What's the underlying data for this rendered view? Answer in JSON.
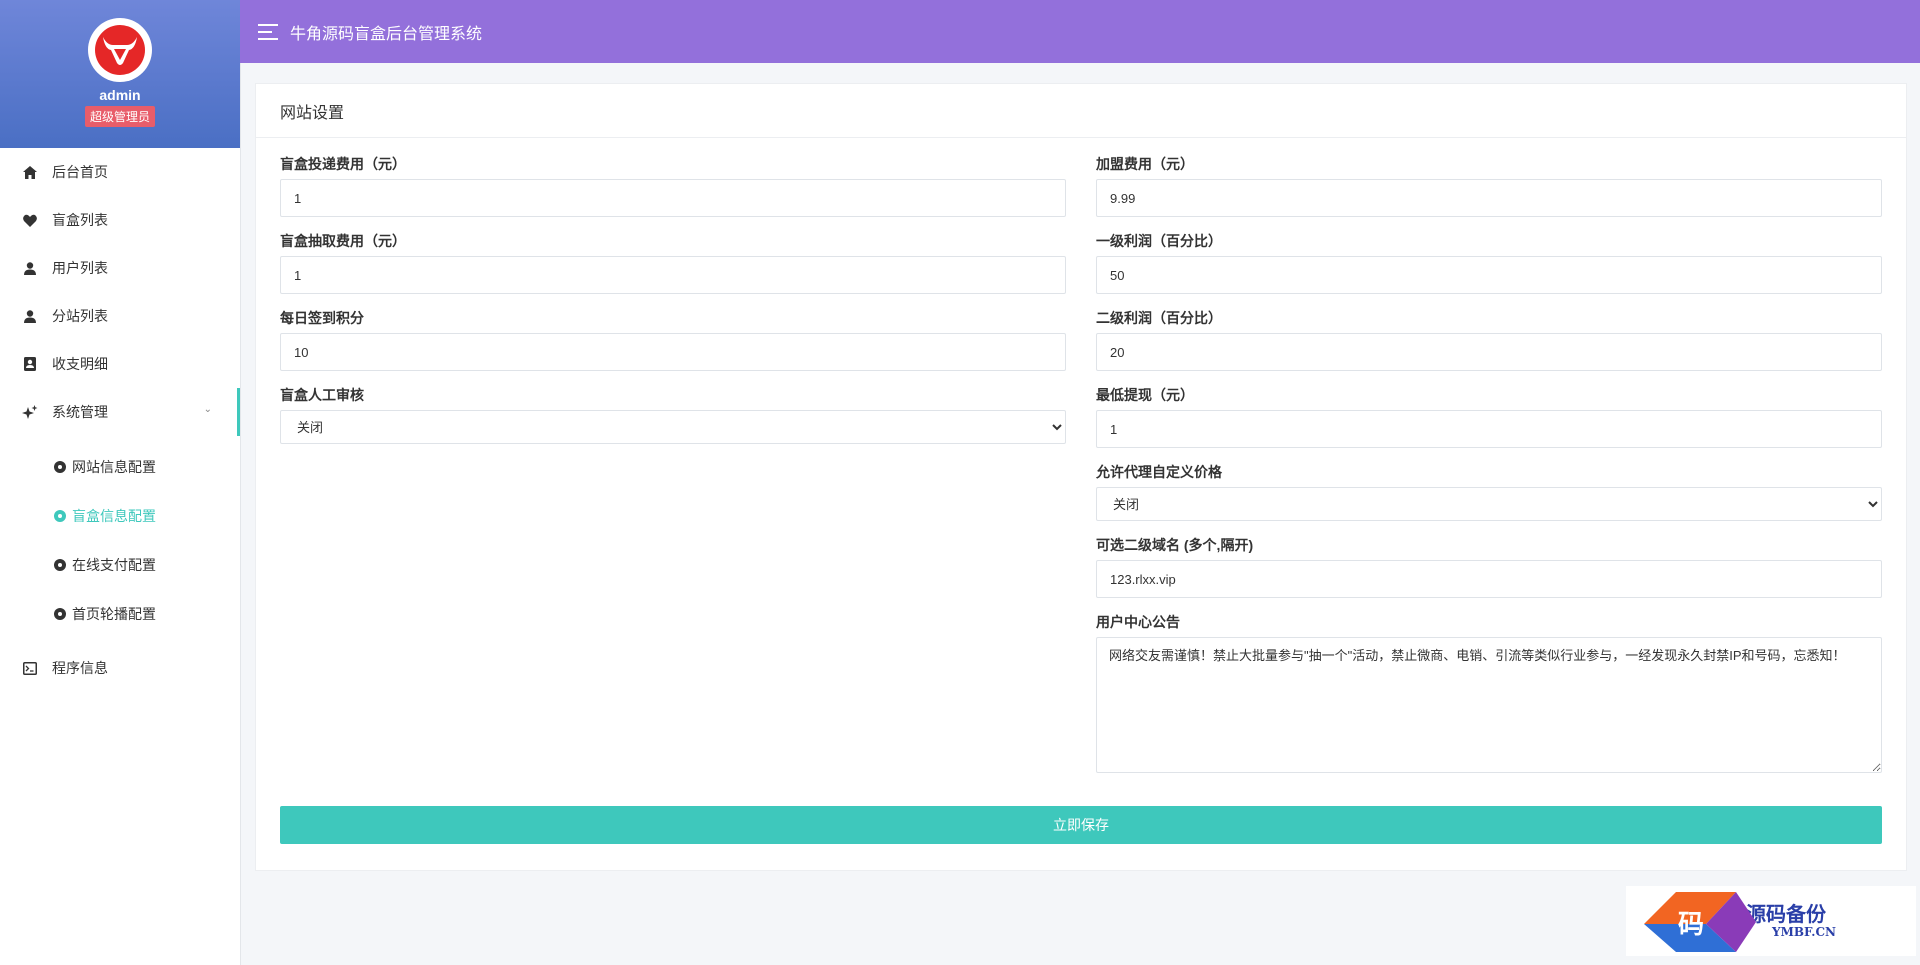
{
  "app": {
    "title": "牛角源码盲盒后台管理系统"
  },
  "profile": {
    "name": "admin",
    "role": "超级管理员"
  },
  "sidebar": {
    "items": [
      {
        "label": "后台首页",
        "icon": "home-icon"
      },
      {
        "label": "盲盒列表",
        "icon": "heart-icon"
      },
      {
        "label": "用户列表",
        "icon": "user-icon"
      },
      {
        "label": "分站列表",
        "icon": "user-icon"
      },
      {
        "label": "收支明细",
        "icon": "contact-card-icon"
      },
      {
        "label": "系统管理",
        "icon": "sparkle-icon"
      },
      {
        "label": "程序信息",
        "icon": "terminal-icon"
      }
    ],
    "submenu": [
      {
        "label": "网站信息配置"
      },
      {
        "label": "盲盒信息配置",
        "active": true
      },
      {
        "label": "在线支付配置"
      },
      {
        "label": "首页轮播配置"
      }
    ]
  },
  "card": {
    "title": "网站设置"
  },
  "form": {
    "left": {
      "deliver_fee": {
        "label": "盲盒投递费用（元）",
        "value": "1"
      },
      "draw_fee": {
        "label": "盲盒抽取费用（元）",
        "value": "1"
      },
      "checkin_points": {
        "label": "每日签到积分",
        "value": "10"
      },
      "manual_review": {
        "label": "盲盒人工审核",
        "value": "关闭"
      }
    },
    "right": {
      "join_fee": {
        "label": "加盟费用（元）",
        "value": "9.99"
      },
      "level1_profit": {
        "label": "一级利润（百分比）",
        "value": "50"
      },
      "level2_profit": {
        "label": "二级利润（百分比）",
        "value": "20"
      },
      "min_withdraw": {
        "label": "最低提现（元）",
        "value": "1"
      },
      "agent_custom_price": {
        "label": "允许代理自定义价格",
        "value": "关闭"
      },
      "subdomains": {
        "label": "可选二级域名 (多个,隔开)",
        "value": "123.rlxx.vip"
      },
      "notice": {
        "label": "用户中心公告",
        "value": "网络交友需谨慎！禁止大批量参与\"抽一个\"活动，禁止微商、电销、引流等类似行业参与，一经发现永久封禁IP和号码，忘悉知！"
      }
    },
    "save_label": "立即保存"
  },
  "watermark": {
    "glyph": "码",
    "main": "源码备份",
    "sub": "YMBF.CN"
  },
  "colors": {
    "topbar": "#9370db",
    "accent": "#3ec8bc",
    "badge": "#e85d6a"
  }
}
